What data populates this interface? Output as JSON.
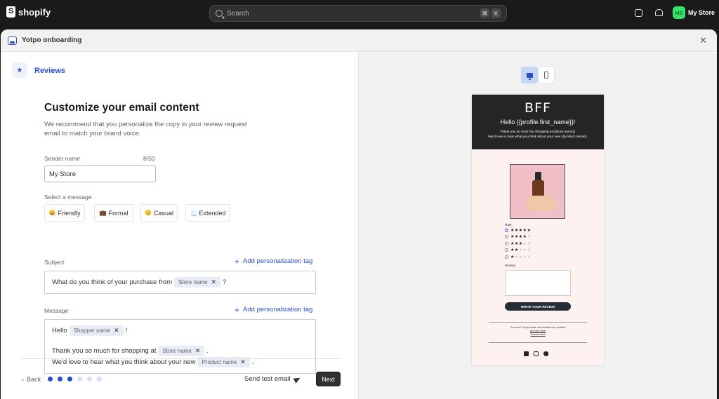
{
  "topbar": {
    "brand": "shopify",
    "search_placeholder": "Search",
    "shortcut_keys": [
      "⌘",
      "K"
    ],
    "store_initials": "MS",
    "store_name": "My Store"
  },
  "modal": {
    "title": "Yotpo onboarding"
  },
  "left": {
    "section_title": "Reviews",
    "heading": "Customize your email content",
    "description": "We recommend that you personalize the copy in your review request email to match your brand voice.",
    "sender": {
      "label": "Sender name",
      "counter": "8/50",
      "value": "My Store"
    },
    "message_select": {
      "label": "Select a message",
      "options": [
        {
          "emoji": "😀",
          "label": "Friendly"
        },
        {
          "emoji": "💼",
          "label": "Formal"
        },
        {
          "emoji": "🙂",
          "label": "Casual"
        },
        {
          "emoji": "📃",
          "label": "Extended"
        }
      ]
    },
    "subject": {
      "label": "Subject",
      "add_tag": "Add personalization tag",
      "text_before": "What do you think of your purchase from",
      "chip": "Store name",
      "text_after": "?"
    },
    "message": {
      "label": "Message",
      "add_tag": "Add personalization tag",
      "line1_before": "Hello",
      "line1_chip": "Shopper name",
      "line1_after": "!",
      "line2_before": "Thank you so much for shopping at",
      "line2_chip": "Store name",
      "line2_after": ".",
      "line3_before": "We'd love to hear what you think about your new",
      "line3_chip": "Product name",
      "line3_after": "."
    },
    "footer": {
      "back": "Back",
      "steps_total": 6,
      "steps_done": 3,
      "send_test": "Send test email",
      "next": "Next"
    }
  },
  "preview": {
    "brand": "BFF",
    "greeting": "Hello {{profile.first_name}}!",
    "line1": "Thank you so much for shopping at {{store.name}}.",
    "line2": "We'd love to hear what you think about your new {{product.name}}.",
    "rate_label": "Rate",
    "ratings": [
      5,
      4,
      3,
      2,
      1
    ],
    "selected_rating": 5,
    "review_label": "Review",
    "cta": "WRITE YOUR REVIEW",
    "footer_line1": "Too soon? If you have not received the product",
    "footer_line2": "yet click here",
    "footer_line3": "Unsubscribe"
  }
}
